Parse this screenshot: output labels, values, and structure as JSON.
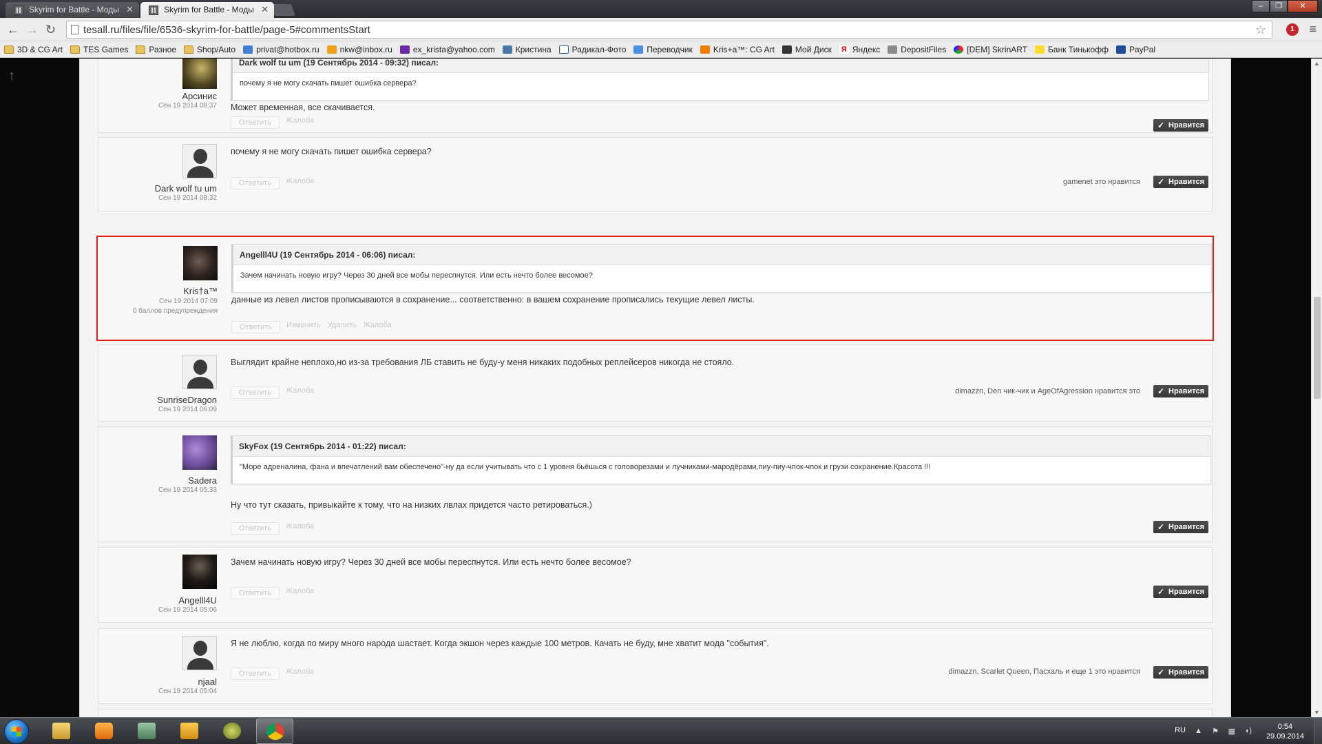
{
  "browser": {
    "tabs": [
      {
        "title": "Skyrim for Battle - Моды"
      },
      {
        "title": "Skyrim for Battle - Моды"
      }
    ],
    "url": "tesall.ru/files/file/6536-skyrim-for-battle/page-5#commentsStart",
    "ext_badge": "1",
    "bookmarks": [
      {
        "label": "3D & CG Art",
        "icon": "folder-icon"
      },
      {
        "label": "TES Games",
        "icon": "folder-icon"
      },
      {
        "label": "Разное",
        "icon": "folder-icon"
      },
      {
        "label": "Shop/Auto",
        "icon": "folder-icon"
      },
      {
        "label": "privat@hotbox.ru",
        "icon": "mail-icon"
      },
      {
        "label": "nkw@inbox.ru",
        "icon": "mail-icon"
      },
      {
        "label": "ex_krista@yahoo.com",
        "icon": "mail-icon"
      },
      {
        "label": "Кристина",
        "icon": "vk-icon"
      },
      {
        "label": "Радикал-Фото",
        "icon": "radikal-icon"
      },
      {
        "label": "Переводчик",
        "icon": "translate-icon"
      },
      {
        "label": "Kris+a™: CG Art",
        "icon": "blogger-icon"
      },
      {
        "label": "Мой Диск",
        "icon": "disk-icon"
      },
      {
        "label": "Яндекс",
        "icon": "yandex-icon"
      },
      {
        "label": "DepositFiles",
        "icon": "depositfiles-icon"
      },
      {
        "label": "[DEM] SkrinART",
        "icon": "skrinart-icon"
      },
      {
        "label": "Банк Тинькофф",
        "icon": "tinkoff-icon"
      },
      {
        "label": "PayPal",
        "icon": "paypal-icon"
      }
    ]
  },
  "labels": {
    "reply": "Ответить",
    "report": "Жалоба",
    "edit": "Изменить",
    "delete": "Удалить",
    "like": "Нравится"
  },
  "posts": [
    {
      "author": "Арсинис",
      "date": "Сен 19 2014 08:37",
      "quote_head": "Dark wolf tu um (19 Сентябрь 2014 - 09:32) писал:",
      "quote_text": "почему я не могу скачать пишет ошибка сервера?",
      "text": "Может временная, все скачивается.",
      "likers": ""
    },
    {
      "author": "Dark wolf tu um",
      "date": "Сен 19 2014 08:32",
      "text": "почему я не могу скачать пишет ошибка сервера?",
      "likers": "gamenet это нравится"
    },
    {
      "author": "Kris†a™",
      "date": "Сен 19 2014 07:09",
      "warn": "0 баллов предупреждения",
      "quote_head": "Angelll4U (19 Сентябрь 2014 - 06:06) писал:",
      "quote_text": "Зачем начинать новую игру? Через 30 дней все мобы переспнутся. Или есть нечто более весомое?",
      "text": "данные из левел листов прописываются в сохранение... соответственно: в вашем сохранение прописались текущие левел листы."
    },
    {
      "author": "SunriseDragon",
      "date": "Сен 19 2014 06:09",
      "text": "Выглядит крайне неплохо,но из-за требования ЛБ ставить не буду-у меня никаких подобных реплейсеров никогда не стояло.",
      "likers": "dimazzn, Den чик-чик и AgeOfAgression нравится это"
    },
    {
      "author": "Sadera",
      "date": "Сен 19 2014 05:33",
      "quote_head": "SkyFox (19 Сентябрь 2014 - 01:22) писал:",
      "quote_text": "\"Море адреналина, фана и впечатлений вам обеспечено\"-ну да если учитывать что с 1 уровня бьёшься с головорезами и лучниками-мародёрами,пиу-пиу-чпок-чпок и грузи сохранение.Красота !!!",
      "text": "Ну что тут сказать, привыкайте к тому, что на низких лвлах придется часто ретироваться.)",
      "likers": ""
    },
    {
      "author": "Angelll4U",
      "date": "Сен 19 2014 05:06",
      "text": "Зачем начинать новую игру? Через 30 дней все мобы переспнутся. Или есть нечто более весомое?",
      "likers": ""
    },
    {
      "author": "njaal",
      "date": "Сен 19 2014 05:04",
      "text": "Я не люблю, когда по миру много народа шастает. Когда экшон через каждые 100 метров. Качать не буду, мне хватит мода \"события\".",
      "likers": "dimazzn, Scarlet Queen, Пасхаль и еще 1 это нравится"
    }
  ],
  "taskbar": {
    "lang": "RU",
    "time": "0:54",
    "date": "29.09.2014"
  }
}
